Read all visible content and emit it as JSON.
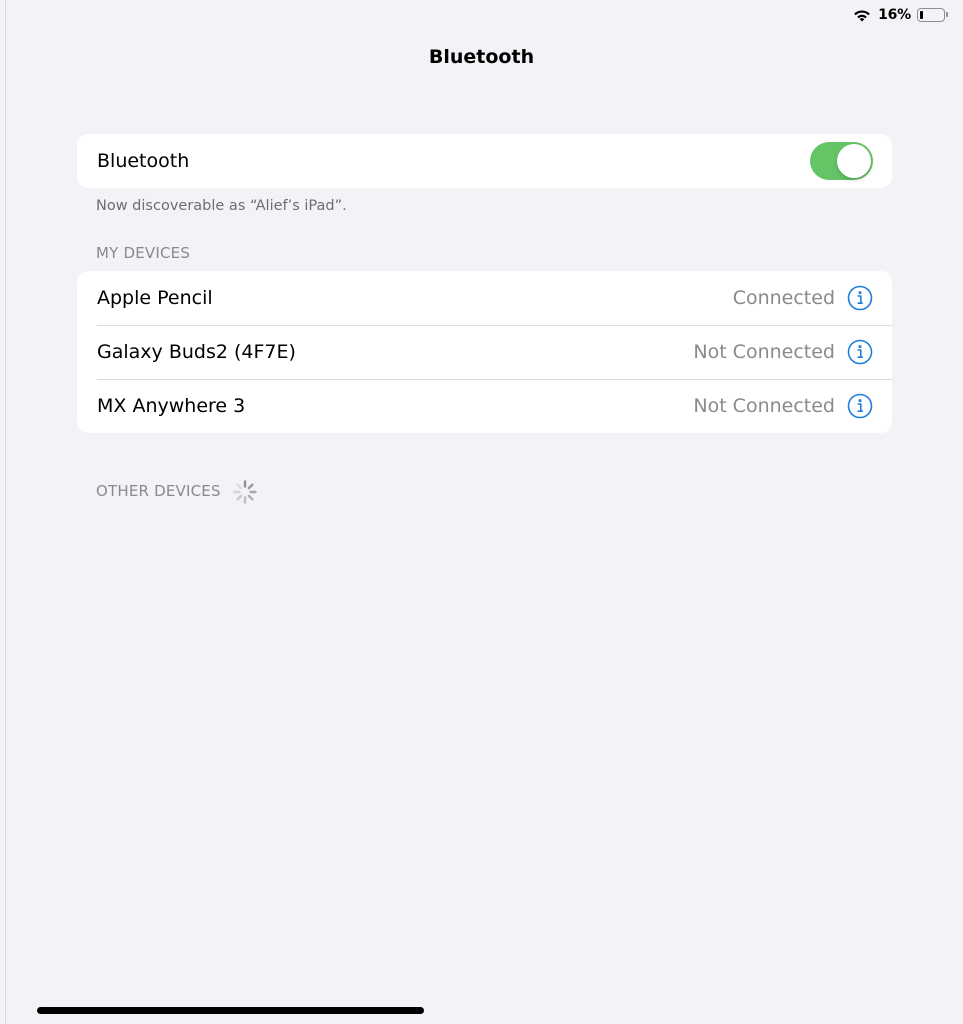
{
  "status_bar": {
    "battery_percent_label": "16%",
    "battery_level": 0.16,
    "wifi_icon": "wifi-icon"
  },
  "nav": {
    "title": "Bluetooth"
  },
  "bluetooth_toggle": {
    "label": "Bluetooth",
    "enabled": true,
    "on_color": "#65c466"
  },
  "discoverable_note": "Now discoverable as “Alief’s iPad”.",
  "my_devices": {
    "header": "MY DEVICES",
    "items": [
      {
        "name": "Apple Pencil",
        "status": "Connected"
      },
      {
        "name": "Galaxy Buds2 (4F7E)",
        "status": "Not Connected"
      },
      {
        "name": "MX Anywhere 3",
        "status": "Not Connected"
      }
    ]
  },
  "other_devices": {
    "header": "OTHER DEVICES"
  },
  "colors": {
    "accent": "#1f7ce0",
    "background": "#f2f2f7",
    "secondary_text": "#8a8a8e"
  }
}
